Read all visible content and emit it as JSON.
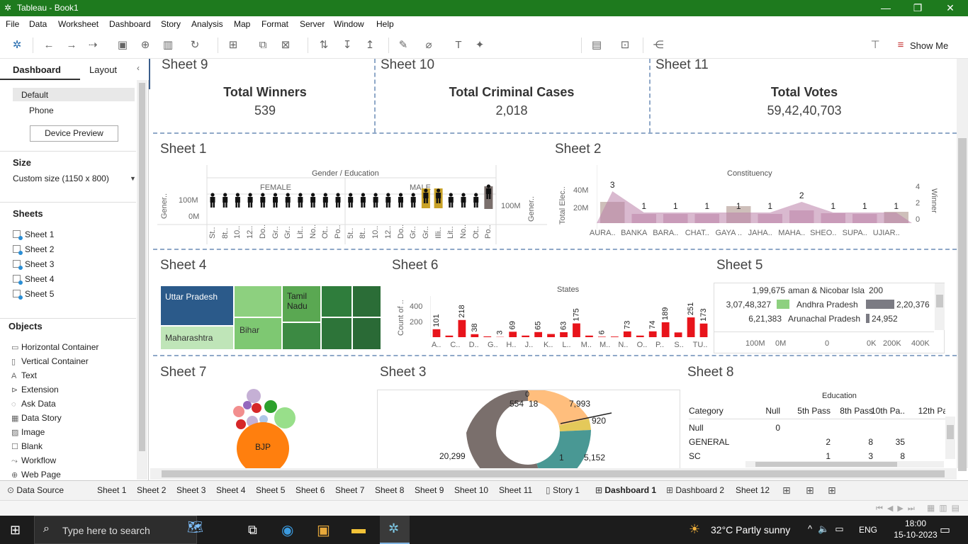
{
  "window": {
    "title": "Tableau - Book1"
  },
  "menu": [
    "File",
    "Data",
    "Worksheet",
    "Dashboard",
    "Story",
    "Analysis",
    "Map",
    "Format",
    "Server",
    "Window",
    "Help"
  ],
  "toolbar": {
    "show_me": "Show Me"
  },
  "left": {
    "tabs": {
      "dashboard": "Dashboard",
      "layout": "Layout"
    },
    "devices": {
      "default": "Default",
      "phone": "Phone",
      "preview_button": "Device Preview"
    },
    "size": {
      "title": "Size",
      "value": "Custom size (1150 x 800)"
    },
    "sheets": {
      "title": "Sheets",
      "items": [
        "Sheet 1",
        "Sheet 2",
        "Sheet 3",
        "Sheet 4",
        "Sheet 5"
      ]
    },
    "objects": {
      "title": "Objects",
      "items": [
        "Horizontal Container",
        "Vertical Container",
        "Text",
        "Extension",
        "Ask Data",
        "Data Story",
        "Image",
        "Blank",
        "Workflow",
        "Web Page"
      ]
    }
  },
  "zones": {
    "sheet9": {
      "title": "Sheet 9",
      "label": "Total Winners",
      "value": "539"
    },
    "sheet10": {
      "title": "Sheet 10",
      "label": "Total Criminal Cases",
      "value": "2,018"
    },
    "sheet11": {
      "title": "Sheet 11",
      "label": "Total Votes",
      "value": "59,42,40,703"
    },
    "sheet1": {
      "title": "Sheet 1",
      "header": "Gender / Education",
      "female": "FEMALE",
      "male": "MALE",
      "yaxis": "Gener..",
      "yaxis_right": "Gener..",
      "ticks": [
        "100M",
        "0M"
      ],
      "right_tick": "100M",
      "cats": [
        "St..",
        "8t..",
        "10..",
        "12..",
        "Do..",
        "Gr..",
        "Gr..",
        "Lit..",
        "No..",
        "Ot..",
        "Po..",
        "5t..",
        "8t..",
        "10..",
        "12..",
        "Do..",
        "Gr..",
        "Gr..",
        "Illi..",
        "Lit..",
        "No..",
        "Ot..",
        "Po.."
      ]
    },
    "sheet2": {
      "title": "Sheet 2",
      "header": "Constituency",
      "yaxis": "Total Elec..",
      "yaxis_right": "Winner",
      "ticks": [
        "40M",
        "20M"
      ],
      "right_ticks": [
        "4",
        "2",
        "0"
      ]
    },
    "sheet4": {
      "title": "Sheet 4",
      "labels": [
        "Uttar Pradesh",
        "Maharashtra",
        "Bihar",
        "Tamil Nadu"
      ]
    },
    "sheet6": {
      "title": "Sheet 6",
      "header": "States",
      "yaxis": "Count of ..",
      "ticks": [
        "400",
        "200"
      ],
      "cats": [
        "A..",
        "C..",
        "D..",
        "G..",
        "H..",
        "J..",
        "K..",
        "L..",
        "M..",
        "M..",
        "N..",
        "O..",
        "P..",
        "S..",
        "TU.."
      ]
    },
    "sheet5": {
      "title": "Sheet 5",
      "rows": [
        {
          "left": "1,99,675",
          "mid": "aman & Nicobar Isla",
          "right": "200"
        },
        {
          "left": "3,07,48,327",
          "mid": "Andhra Pradesh",
          "right": "2,20,376"
        },
        {
          "left": "6,21,383",
          "mid": "Arunachal Pradesh",
          "right": "24,952"
        }
      ],
      "axis": [
        "100M",
        "0M",
        "0",
        "0K",
        "200K",
        "400K"
      ]
    },
    "sheet7": {
      "title": "Sheet 7",
      "big": "BJP"
    },
    "sheet3": {
      "title": "Sheet 3",
      "labels": [
        "0",
        "554",
        "18",
        "7,993",
        "920",
        "20,299",
        "1",
        "5,152"
      ]
    },
    "sheet8": {
      "title": "Sheet 8",
      "header": "Education",
      "cols": [
        "Category",
        "Null",
        "5th Pass",
        "8th Pass",
        "10th Pa..",
        "12th Pa"
      ],
      "rows": [
        [
          "Null",
          "0",
          "",
          "",
          "",
          ""
        ],
        [
          "GENERAL",
          "",
          "2",
          "8",
          "35",
          ""
        ],
        [
          "SC",
          "",
          "1",
          "3",
          "8",
          ""
        ]
      ]
    }
  },
  "chart_data": [
    {
      "type": "bar",
      "title": "Sheet 2",
      "xlabel": "Constituency",
      "ylabel": "Total Elec..",
      "categories": [
        "AURA..",
        "BANKA",
        "BARA..",
        "CHAT..",
        "GAYA ..",
        "JAHA..",
        "MAHA..",
        "SHEO..",
        "SUPA..",
        "UJIAR.."
      ],
      "series": [
        {
          "name": "Winner",
          "values": [
            3,
            1,
            1,
            1,
            1,
            1,
            2,
            1,
            1,
            1
          ]
        }
      ],
      "ylim": [
        0,
        4
      ]
    },
    {
      "type": "bar",
      "title": "Sheet 6",
      "xlabel": "States",
      "ylabel": "Count of ..",
      "categories": [
        "A..",
        "C..",
        "D..",
        "G..",
        "H..",
        "J..",
        "K..",
        "L..",
        "M..",
        "M..",
        "N..",
        "O..",
        "P..",
        "S..",
        "TU.."
      ],
      "labels": [
        "101",
        "218",
        "38",
        "3",
        "69",
        "65",
        "63",
        "175",
        "6",
        "73",
        "74",
        "189",
        "251",
        "173"
      ],
      "values": [
        101,
        20,
        218,
        38,
        10,
        3,
        69,
        20,
        65,
        40,
        63,
        175,
        20,
        6,
        8,
        73,
        20,
        74,
        189,
        60,
        251,
        173
      ],
      "ylim": [
        0,
        450
      ]
    }
  ],
  "tabs": [
    "Data Source",
    "Sheet 1",
    "Sheet 2",
    "Sheet 3",
    "Sheet 4",
    "Sheet 5",
    "Sheet 6",
    "Sheet 7",
    "Sheet 8",
    "Sheet 9",
    "Sheet 10",
    "Sheet 11",
    "Story 1",
    "Dashboard 1",
    "Dashboard 2",
    "Sheet 12"
  ],
  "taskbar": {
    "search": "Type here to search",
    "weather": "32°C  Partly sunny",
    "lang": "ENG",
    "time": "18:00",
    "date": "15-10-2023"
  }
}
